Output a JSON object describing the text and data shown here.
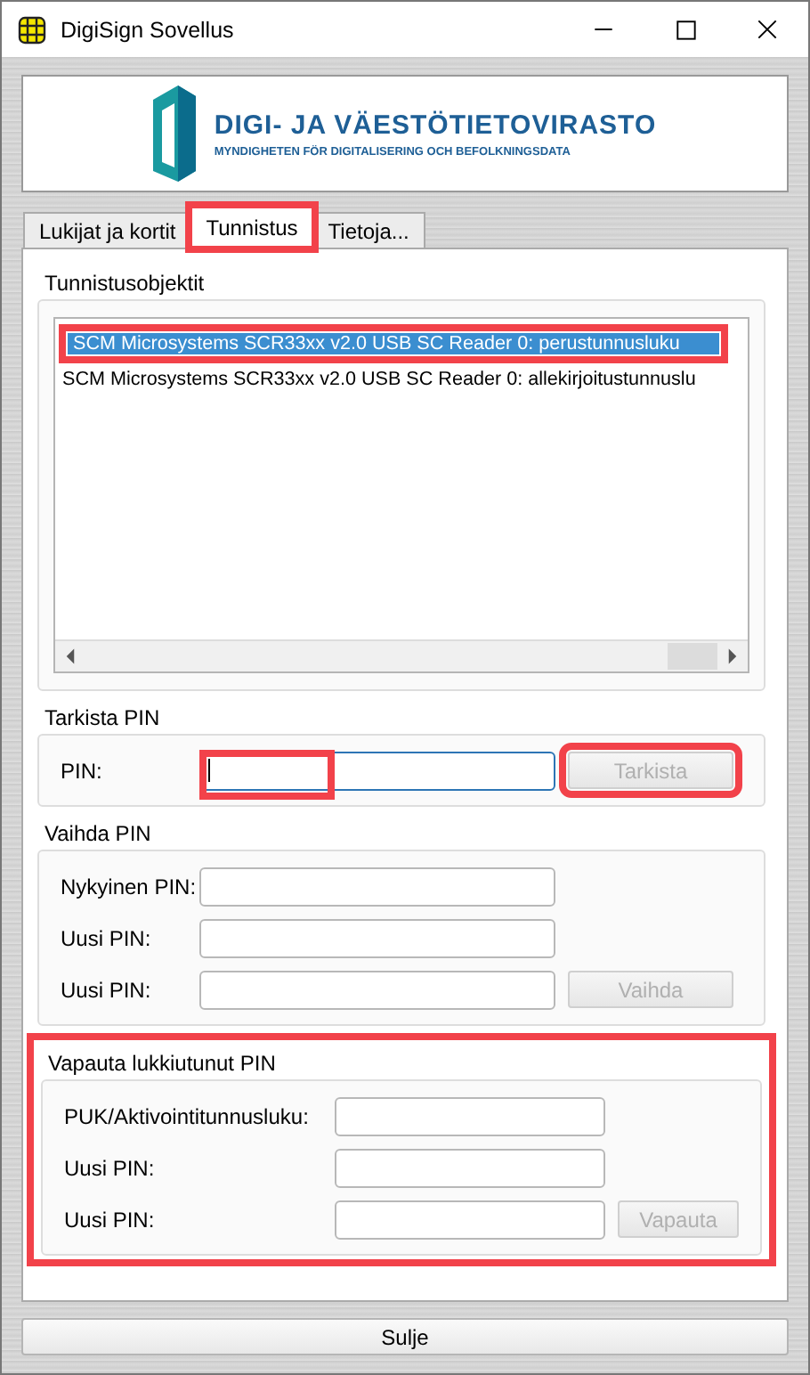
{
  "window": {
    "title": "DigiSign Sovellus"
  },
  "logo": {
    "name": "DIGI- JA VÄESTÖTIETOVIRASTO",
    "subtitle": "MYNDIGHETEN FÖR DIGITALISERING OCH BEFOLKNINGSDATA"
  },
  "tabs": [
    {
      "label": "Lukijat ja kortit",
      "selected": false,
      "highlighted": false
    },
    {
      "label": "Tunnistus",
      "selected": true,
      "highlighted": true
    },
    {
      "label": "Tietoja...",
      "selected": false,
      "highlighted": false
    }
  ],
  "objects": {
    "title": "Tunnistusobjektit",
    "items": [
      {
        "label": "SCM Microsystems SCR33xx v2.0 USB SC Reader 0: perustunnusluku",
        "selected": true,
        "highlighted": true
      },
      {
        "label": "SCM Microsystems SCR33xx v2.0 USB SC Reader 0: allekirjoitustunnuslu",
        "selected": false,
        "highlighted": false
      }
    ]
  },
  "sections": [
    {
      "title": "Tarkista PIN",
      "highlighted": false,
      "fields": [
        {
          "label": "PIN:",
          "focused": true,
          "highlighted": true
        }
      ],
      "button": {
        "label": "Tarkista",
        "disabled": true,
        "highlighted": true
      }
    },
    {
      "title": "Vaihda PIN",
      "highlighted": false,
      "fields": [
        {
          "label": "Nykyinen PIN:",
          "focused": false,
          "highlighted": false
        },
        {
          "label": "Uusi PIN:",
          "focused": false,
          "highlighted": false
        },
        {
          "label": "Uusi PIN:",
          "focused": false,
          "highlighted": false
        }
      ],
      "button": {
        "label": "Vaihda",
        "disabled": true,
        "highlighted": false
      }
    },
    {
      "title": "Vapauta lukkiutunut PIN",
      "highlighted": true,
      "fields": [
        {
          "label": "PUK/Aktivointitunnusluku:",
          "focused": false,
          "highlighted": false
        },
        {
          "label": "Uusi PIN:",
          "focused": false,
          "highlighted": false
        },
        {
          "label": "Uusi PIN:",
          "focused": false,
          "highlighted": false
        }
      ],
      "button": {
        "label": "Vapauta",
        "disabled": true,
        "highlighted": false
      }
    }
  ],
  "close_button": {
    "label": "Sulje"
  }
}
